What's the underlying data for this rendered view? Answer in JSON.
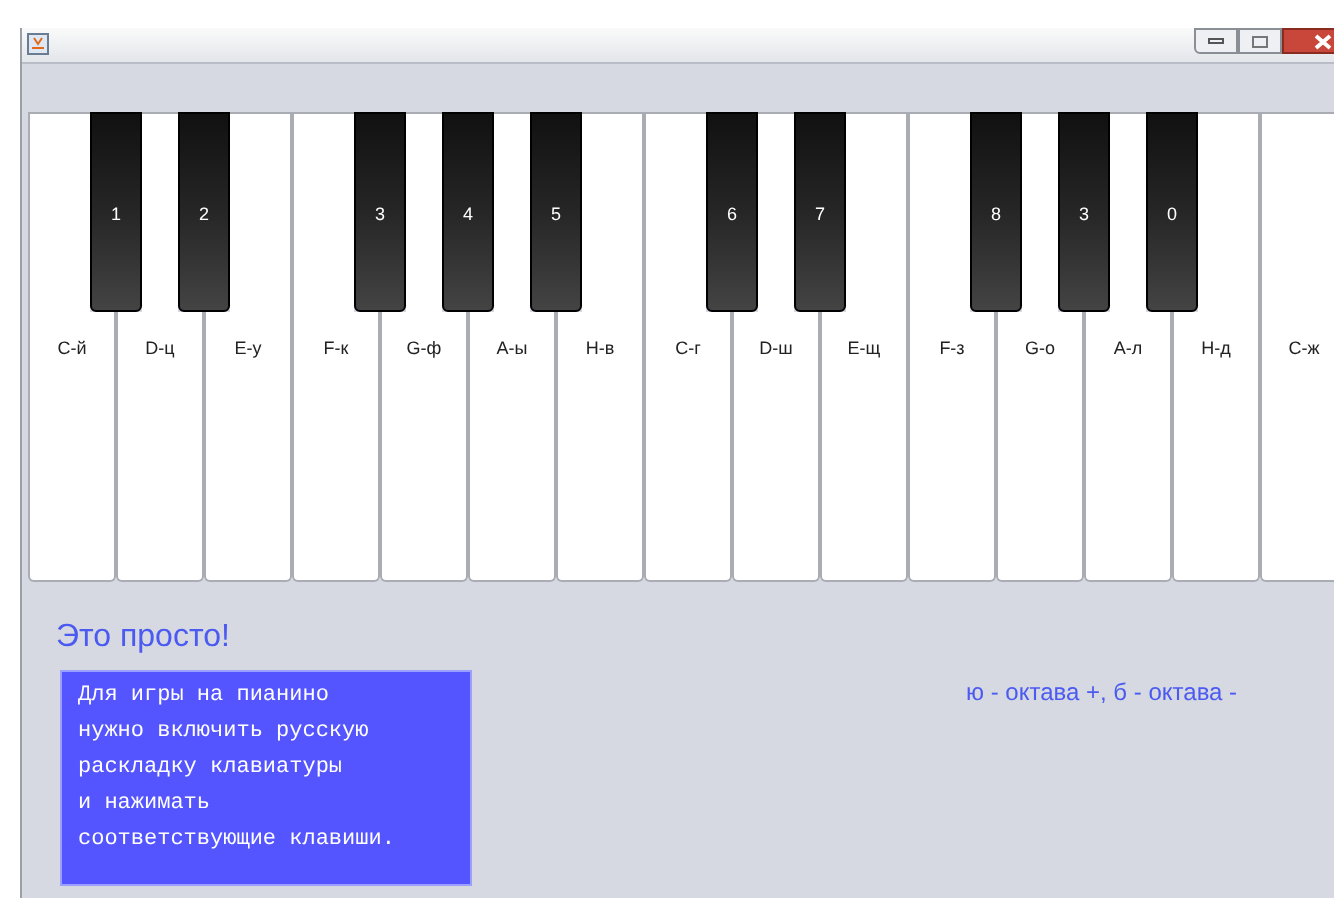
{
  "keys": [
    {
      "label": "C-й",
      "black": {
        "label": "1"
      }
    },
    {
      "label": "D-ц",
      "black": {
        "label": "2"
      }
    },
    {
      "label": "E-у"
    },
    {
      "label": "F-к",
      "black": {
        "label": "3"
      }
    },
    {
      "label": "G-ф",
      "black": {
        "label": "4"
      }
    },
    {
      "label": "A-ы",
      "black": {
        "label": "5"
      }
    },
    {
      "label": "H-в"
    },
    {
      "label": "C-г",
      "black": {
        "label": "6"
      }
    },
    {
      "label": "D-ш",
      "black": {
        "label": "7"
      }
    },
    {
      "label": "E-щ"
    },
    {
      "label": "F-з",
      "black": {
        "label": "8"
      }
    },
    {
      "label": "G-о",
      "black": {
        "label": "3"
      }
    },
    {
      "label": "A-л",
      "black": {
        "label": "0"
      }
    },
    {
      "label": "H-д"
    },
    {
      "label": "C-ж"
    }
  ],
  "heading": "Это просто!",
  "instructions": "Для игры на пианино\nнужно включить русскую\nраскладку клавиатуры\nи нажимать\nсоответствующие клавиши.",
  "octave_hint": "ю - октава +, б - октава -"
}
